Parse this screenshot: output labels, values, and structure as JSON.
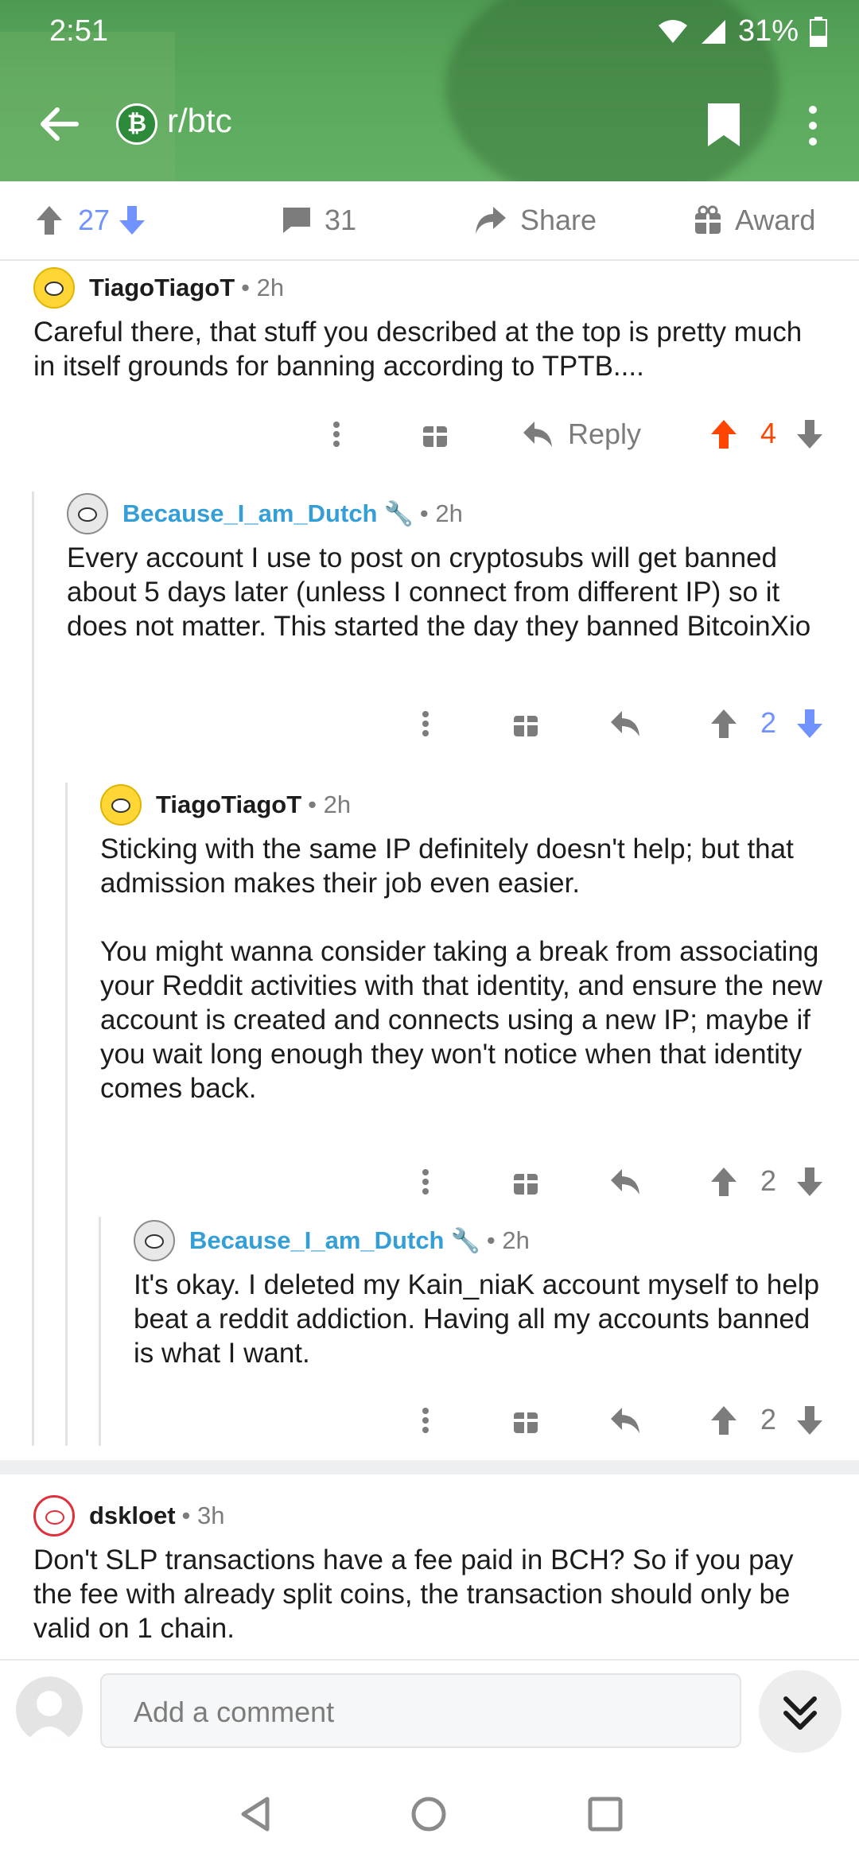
{
  "status_bar": {
    "time": "2:51",
    "battery": "31%"
  },
  "toolbar": {
    "subreddit": "r/btc",
    "subreddit_icon": "bitcoin-icon"
  },
  "post_actions": {
    "score": "27",
    "comments": "31",
    "share_label": "Share",
    "award_label": "Award"
  },
  "comments": [
    {
      "author": "TiagoTiagoT",
      "time": "2h",
      "body": [
        "Careful there, that stuff you described at the top is pretty much in itself grounds for banning according to TPTB...."
      ],
      "reply_label": "Reply",
      "score": "4",
      "vote_state": "upvoted"
    },
    {
      "author": "Because_I_am_Dutch",
      "time": "2h",
      "body": [
        "Every account I use to post on cryptosubs will get banned about 5 days later (unless I connect from different IP) so it does not matter. This started the day they banned BitcoinXio"
      ],
      "score": "2",
      "vote_state": "downvoted"
    },
    {
      "author": "TiagoTiagoT",
      "time": "2h",
      "body": [
        "Sticking with the same IP definitely doesn't help; but that admission makes their job even easier.",
        "You might wanna consider taking a break from associating your Reddit activities with that identity, and ensure the new account is created and connects using a new IP; maybe if you wait long enough they won't notice when that identity comes back."
      ],
      "score": "2",
      "vote_state": "none"
    },
    {
      "author": "Because_I_am_Dutch",
      "time": "2h",
      "body": [
        "It's okay. I deleted my Kain_niaK account myself to help beat a reddit addiction. Having all my accounts banned is what I want."
      ],
      "score": "2",
      "vote_state": "none"
    },
    {
      "author": "dskloet",
      "time": "3h",
      "body": [
        "Don't SLP transactions have a fee paid in BCH? So if you pay the fee with already split coins, the transaction should only be valid on 1 chain."
      ]
    }
  ],
  "comment_bar": {
    "placeholder": "Add a comment"
  },
  "colors": {
    "upvote": "#ff4500",
    "downvote": "#7193ff",
    "header_green": "#5aa85c",
    "mod_blue": "#349ed6"
  }
}
